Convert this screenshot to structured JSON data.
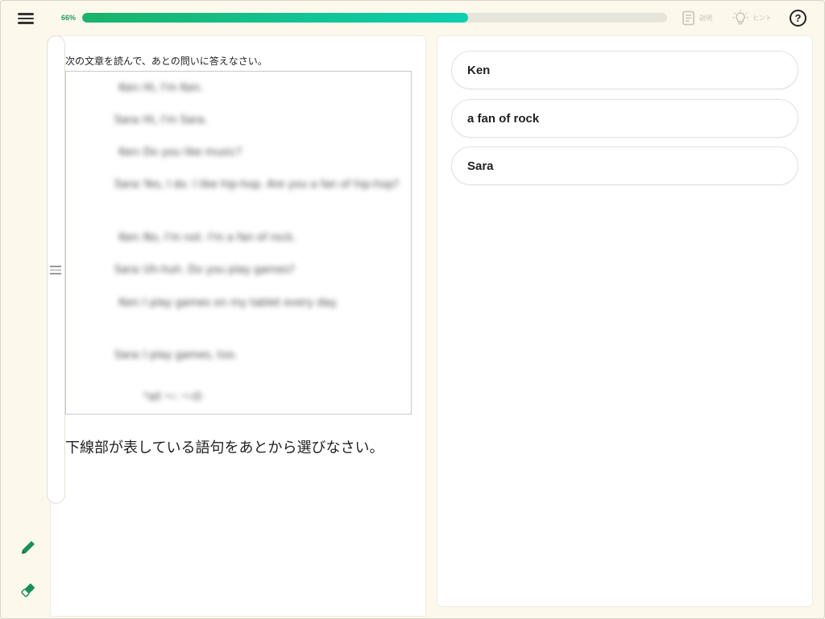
{
  "header": {
    "progress_label": "66%",
    "progress_value": 0.66,
    "explanation_label": "説明",
    "hint_label": "ヒント",
    "help_label": "?",
    "accent_color": "#19b36b"
  },
  "tools": {
    "pencil_icon": "pencil-icon",
    "eraser_icon": "eraser-icon",
    "menu_icon": "menu-icon"
  },
  "passage": {
    "instruction": "次の文章を読んで、あとの問いに答えなさい。",
    "lines": [
      {
        "speaker": "Ken:",
        "text": "Hi, I'm Ken."
      },
      {
        "speaker": "Sara:",
        "text": "Hi, I'm Sara."
      },
      {
        "speaker": "Ken:",
        "text": "Do you like music?"
      },
      {
        "speaker": "Sara:",
        "text": "Yes, I do.  I like hip-hop.  Are you a fan of hip-hop?"
      },
      {
        "speaker": "Ken:",
        "text": "No, I'm not.  I'm a fan of rock."
      },
      {
        "speaker": "Sara:",
        "text": "Uh-huh.  Do you play games?"
      },
      {
        "speaker": "Ken:",
        "text": "I play games on my tablet every day."
      },
      {
        "speaker": "Sara:",
        "text": "I play games, too."
      },
      {
        "speaker": "",
        "text": "*all ～: ～の"
      }
    ]
  },
  "question": {
    "text": "下線部が表している語句をあとから選びなさい。"
  },
  "choices": [
    {
      "label": "Ken"
    },
    {
      "label": "a fan of rock"
    },
    {
      "label": "Sara"
    }
  ]
}
